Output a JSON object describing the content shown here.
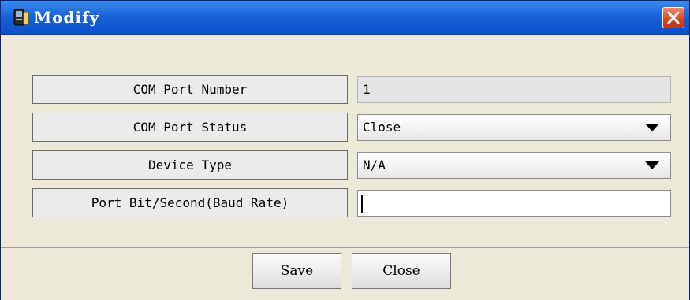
{
  "window": {
    "title": "Modify",
    "icon": "pda-icon",
    "close_icon": "close-icon"
  },
  "form": {
    "com_port_number": {
      "label": "COM Port Number",
      "value": "1"
    },
    "com_port_status": {
      "label": "COM Port Status",
      "value": "Close"
    },
    "device_type": {
      "label": "Device Type",
      "value": "N/A"
    },
    "baud_rate": {
      "label": "Port Bit/Second(Baud Rate)",
      "value": ""
    }
  },
  "buttons": {
    "save": "Save",
    "close": "Close"
  },
  "colors": {
    "titlebar": "#1a62d8",
    "close_button": "#d9431d",
    "dialog_bg": "#ece9d8"
  }
}
